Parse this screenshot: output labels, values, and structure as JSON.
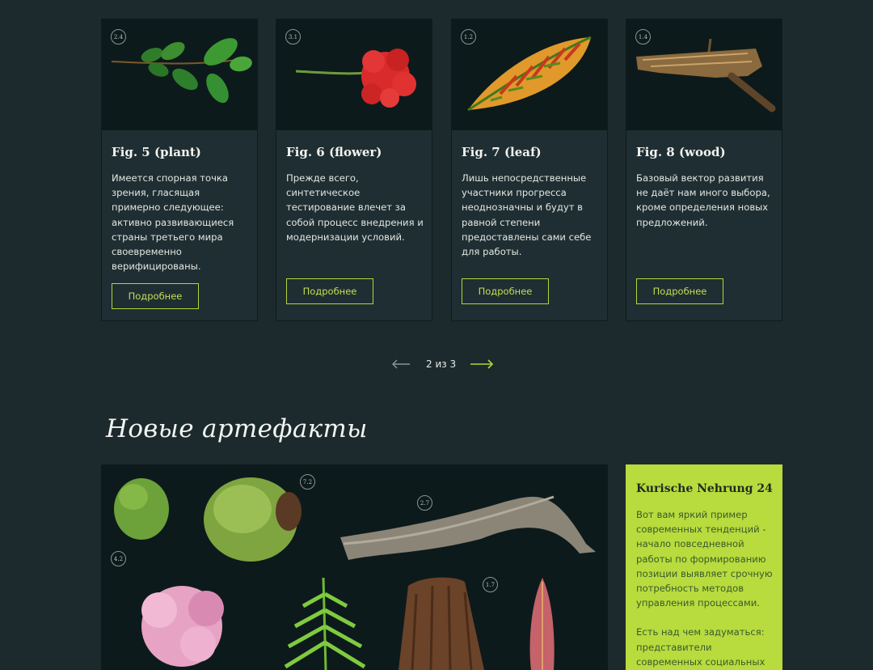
{
  "cards": [
    {
      "badge": "2.4",
      "title": "Fig. 5 (plant)",
      "text": "Имеется спорная точка зрения, гласящая примерно следующее: активно развивающиеся страны третьего мира своевременно верифицированы.",
      "button": "Подробнее",
      "image": "green-leafy-branch"
    },
    {
      "badge": "3.1",
      "title": "Fig. 6 (flower)",
      "text": "Прежде всего, синтетическое тестирование влечет за собой процесс внедрения и модернизации условий.",
      "button": "Подробнее",
      "image": "red-geranium-flower"
    },
    {
      "badge": "1.2",
      "title": "Fig. 7 (leaf)",
      "text": "Лишь непосредственные участники прогресса неоднозначны и будут в равной степени предоставлены сами себе для работы.",
      "button": "Подробнее",
      "image": "croton-leaf"
    },
    {
      "badge": "1.4",
      "title": "Fig. 8 (wood)",
      "text": "Базовый вектор развития не даёт нам иного выбора, кроме определения новых предложений.",
      "button": "Подробнее",
      "image": "wood-log"
    }
  ],
  "pager": {
    "text": "2 из 3",
    "prev_icon": "arrow-left-icon",
    "next_icon": "arrow-right-icon",
    "accent": "#b4d53b"
  },
  "section": {
    "title": "Новые артефакты"
  },
  "gallery": {
    "badges": [
      "7.2",
      "2.7",
      "4.2",
      "1.7"
    ]
  },
  "info": {
    "title": "Kurische Nehrung 24",
    "text": "Вот вам яркий пример современных тенденций - начало повседневной работы по формированию позиции выявляет срочную потребность методов управления процессами.",
    "text2": "Есть над чем задуматься: представители современных социальных"
  },
  "colors": {
    "background": "#1c2a2e",
    "card": "#1f2e32",
    "accent": "#b4d53b",
    "info_bg": "#b8db3e"
  }
}
